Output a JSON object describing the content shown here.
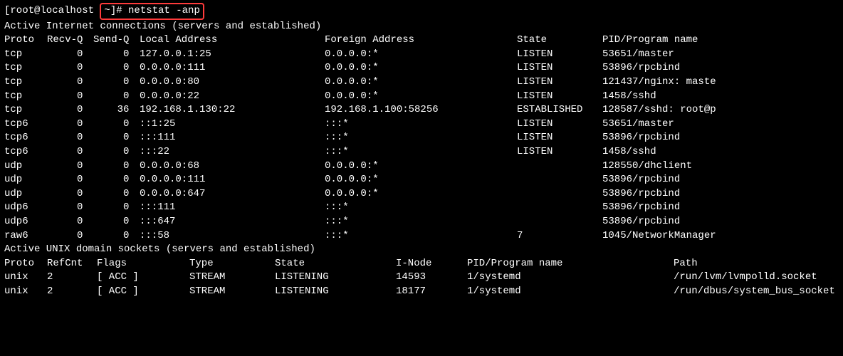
{
  "prompt": {
    "prefix": "[root@localhost ",
    "highlighted": "~]# netstat -anp",
    "suffix": ""
  },
  "header1": "Active Internet connections (servers and established)",
  "inet_header": {
    "proto": "Proto",
    "recvq": "Recv-Q",
    "sendq": "Send-Q",
    "local": "Local Address",
    "foreign": "Foreign Address",
    "state": "State",
    "pidprog": "PID/Program name"
  },
  "inet_rows": [
    {
      "proto": "tcp",
      "recvq": "0",
      "sendq": "0",
      "local": "127.0.0.1:25",
      "foreign": "0.0.0.0:*",
      "state": "LISTEN",
      "pidprog": "53651/master"
    },
    {
      "proto": "tcp",
      "recvq": "0",
      "sendq": "0",
      "local": "0.0.0.0:111",
      "foreign": "0.0.0.0:*",
      "state": "LISTEN",
      "pidprog": "53896/rpcbind"
    },
    {
      "proto": "tcp",
      "recvq": "0",
      "sendq": "0",
      "local": "0.0.0.0:80",
      "foreign": "0.0.0.0:*",
      "state": "LISTEN",
      "pidprog": "121437/nginx: maste"
    },
    {
      "proto": "tcp",
      "recvq": "0",
      "sendq": "0",
      "local": "0.0.0.0:22",
      "foreign": "0.0.0.0:*",
      "state": "LISTEN",
      "pidprog": "1458/sshd"
    },
    {
      "proto": "tcp",
      "recvq": "0",
      "sendq": "36",
      "local": "192.168.1.130:22",
      "foreign": "192.168.1.100:58256",
      "state": "ESTABLISHED",
      "pidprog": "128587/sshd: root@p"
    },
    {
      "proto": "tcp6",
      "recvq": "0",
      "sendq": "0",
      "local": "::1:25",
      "foreign": ":::*",
      "state": "LISTEN",
      "pidprog": "53651/master"
    },
    {
      "proto": "tcp6",
      "recvq": "0",
      "sendq": "0",
      "local": ":::111",
      "foreign": ":::*",
      "state": "LISTEN",
      "pidprog": "53896/rpcbind"
    },
    {
      "proto": "tcp6",
      "recvq": "0",
      "sendq": "0",
      "local": ":::22",
      "foreign": ":::*",
      "state": "LISTEN",
      "pidprog": "1458/sshd"
    },
    {
      "proto": "udp",
      "recvq": "0",
      "sendq": "0",
      "local": "0.0.0.0:68",
      "foreign": "0.0.0.0:*",
      "state": "",
      "pidprog": "128550/dhclient"
    },
    {
      "proto": "udp",
      "recvq": "0",
      "sendq": "0",
      "local": "0.0.0.0:111",
      "foreign": "0.0.0.0:*",
      "state": "",
      "pidprog": "53896/rpcbind"
    },
    {
      "proto": "udp",
      "recvq": "0",
      "sendq": "0",
      "local": "0.0.0.0:647",
      "foreign": "0.0.0.0:*",
      "state": "",
      "pidprog": "53896/rpcbind"
    },
    {
      "proto": "udp6",
      "recvq": "0",
      "sendq": "0",
      "local": ":::111",
      "foreign": ":::*",
      "state": "",
      "pidprog": "53896/rpcbind"
    },
    {
      "proto": "udp6",
      "recvq": "0",
      "sendq": "0",
      "local": ":::647",
      "foreign": ":::*",
      "state": "",
      "pidprog": "53896/rpcbind"
    },
    {
      "proto": "raw6",
      "recvq": "0",
      "sendq": "0",
      "local": ":::58",
      "foreign": ":::*",
      "state": "7",
      "pidprog": "1045/NetworkManager"
    }
  ],
  "header2": "Active UNIX domain sockets (servers and established)",
  "unix_header": {
    "proto": "Proto",
    "refcnt": "RefCnt",
    "flags": "Flags",
    "type": "Type",
    "state": "State",
    "inode": "I-Node",
    "pidprog": "PID/Program name",
    "path": "Path"
  },
  "unix_rows": [
    {
      "proto": "unix",
      "refcnt": "2",
      "flags": "[ ACC ]",
      "type": "STREAM",
      "state": "LISTENING",
      "inode": "14593",
      "pidprog": "1/systemd",
      "path": "/run/lvm/lvmpolld.socket"
    },
    {
      "proto": "unix",
      "refcnt": "2",
      "flags": "[ ACC ]",
      "type": "STREAM",
      "state": "LISTENING",
      "inode": "18177",
      "pidprog": "1/systemd",
      "path": "/run/dbus/system_bus_socket"
    }
  ]
}
